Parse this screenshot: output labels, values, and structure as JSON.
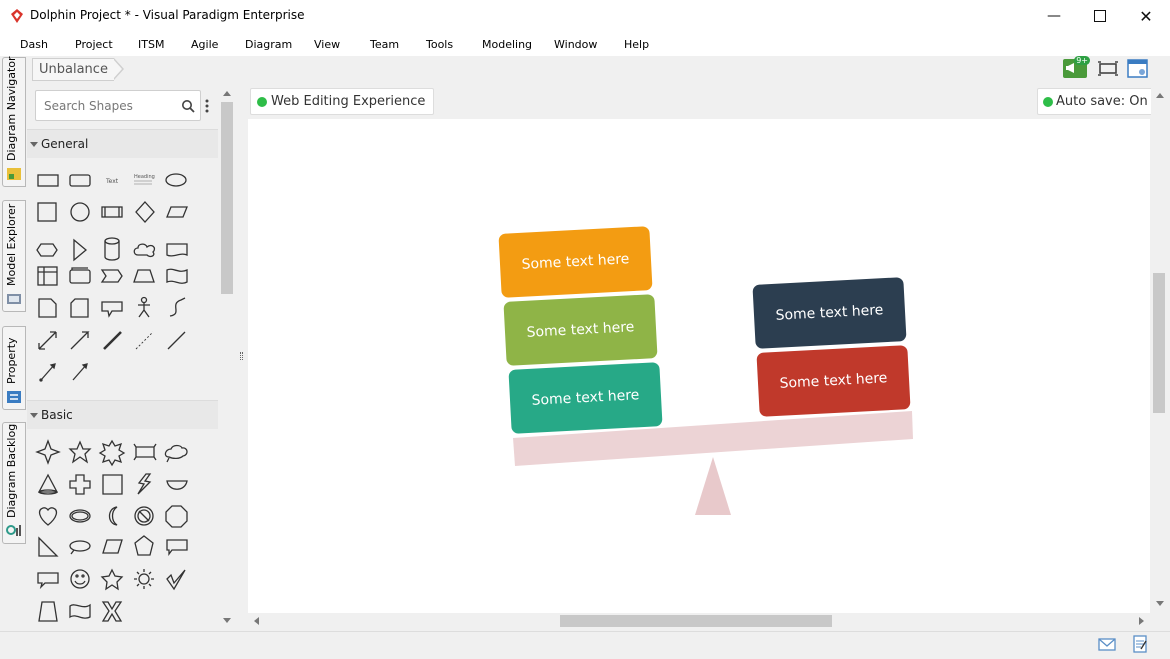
{
  "window": {
    "title": "Dolphin Project * - Visual Paradigm Enterprise"
  },
  "menu": [
    "Dash",
    "Project",
    "ITSM",
    "Agile",
    "Diagram",
    "View",
    "Team",
    "Tools",
    "Modeling",
    "Window",
    "Help"
  ],
  "breadcrumb": "Unbalance",
  "toolbar": {
    "notification_badge": "9+"
  },
  "side_tabs": [
    "Diagram Navigator",
    "Model Explorer",
    "Property",
    "Diagram Backlog"
  ],
  "shapes_panel": {
    "search_placeholder": "Search Shapes",
    "sections": [
      {
        "title": "General"
      },
      {
        "title": "Basic"
      }
    ],
    "text_shape_label": "Text",
    "heading_shape_label": "Heading"
  },
  "canvas": {
    "web_badge": "Web Editing Experience",
    "autosave_badge": "Auto save: On",
    "boxes": [
      {
        "text": "Some text here",
        "color": "#f39c12"
      },
      {
        "text": "Some text here",
        "color": "#8fb447"
      },
      {
        "text": "Some text here",
        "color": "#27a987"
      },
      {
        "text": "Some text here",
        "color": "#2c3e50"
      },
      {
        "text": "Some text here",
        "color": "#c0392b"
      }
    ],
    "beam_color": "#ecd3d5",
    "status_color": "#2ebd48"
  }
}
